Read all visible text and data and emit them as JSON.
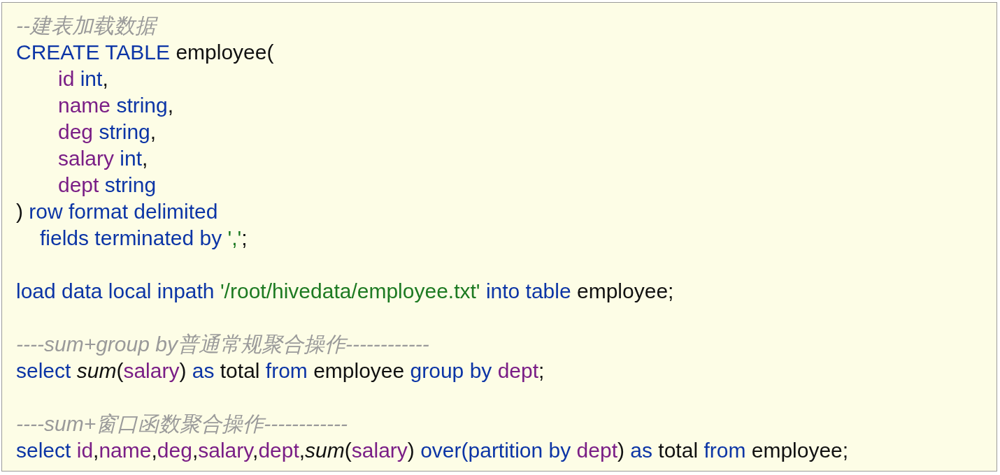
{
  "blocks": [
    {
      "lines": [
        {
          "kind": "plain",
          "tokens": [
            {
              "kind": "comment",
              "text": "--建表加载数据"
            }
          ]
        },
        {
          "kind": "plain",
          "tokens": [
            {
              "kind": "keyword",
              "text": "CREATE TABLE"
            },
            {
              "kind": "plain",
              "text": " employee("
            }
          ]
        },
        {
          "kind": "column",
          "tokens": [
            {
              "kind": "column",
              "text": "id"
            },
            {
              "kind": "keyword",
              "text": " int"
            },
            {
              "kind": "plain",
              "text": ","
            }
          ]
        },
        {
          "kind": "column",
          "tokens": [
            {
              "kind": "column",
              "text": "name"
            },
            {
              "kind": "keyword",
              "text": " string"
            },
            {
              "kind": "plain",
              "text": ","
            }
          ]
        },
        {
          "kind": "column",
          "tokens": [
            {
              "kind": "column",
              "text": "deg"
            },
            {
              "kind": "keyword",
              "text": " string"
            },
            {
              "kind": "plain",
              "text": ","
            }
          ]
        },
        {
          "kind": "column",
          "tokens": [
            {
              "kind": "column",
              "text": "salary"
            },
            {
              "kind": "keyword",
              "text": " int"
            },
            {
              "kind": "plain",
              "text": ","
            }
          ]
        },
        {
          "kind": "column",
          "tokens": [
            {
              "kind": "column",
              "text": "dept"
            },
            {
              "kind": "keyword",
              "text": " string"
            }
          ]
        },
        {
          "kind": "plain",
          "tokens": [
            {
              "kind": "plain",
              "text": ") "
            },
            {
              "kind": "keyword",
              "text": "row format delimited"
            }
          ]
        },
        {
          "kind": "continuation",
          "tokens": [
            {
              "kind": "keyword",
              "text": "fields terminated by "
            },
            {
              "kind": "string",
              "text": "','"
            },
            {
              "kind": "plain",
              "text": ";"
            }
          ]
        }
      ]
    },
    {
      "lines": [
        {
          "kind": "plain",
          "tokens": [
            {
              "kind": "keyword",
              "text": "load data local inpath "
            },
            {
              "kind": "string",
              "text": "'/root/hivedata/employee.txt'"
            },
            {
              "kind": "keyword",
              "text": " into table"
            },
            {
              "kind": "plain",
              "text": " employee;"
            }
          ]
        }
      ]
    },
    {
      "lines": [
        {
          "kind": "plain",
          "tokens": [
            {
              "kind": "comment",
              "text": "----sum+group by普通常规聚合操作------------"
            }
          ]
        },
        {
          "kind": "plain",
          "tokens": [
            {
              "kind": "keyword",
              "text": "select "
            },
            {
              "kind": "function",
              "text": "sum"
            },
            {
              "kind": "plain",
              "text": "("
            },
            {
              "kind": "column",
              "text": "salary"
            },
            {
              "kind": "plain",
              "text": ") "
            },
            {
              "kind": "keyword",
              "text": "as"
            },
            {
              "kind": "plain",
              "text": " total "
            },
            {
              "kind": "keyword",
              "text": "from"
            },
            {
              "kind": "plain",
              "text": " employee "
            },
            {
              "kind": "keyword",
              "text": "group by"
            },
            {
              "kind": "column",
              "text": " dept"
            },
            {
              "kind": "plain",
              "text": ";"
            }
          ]
        }
      ]
    },
    {
      "lines": [
        {
          "kind": "plain",
          "tokens": [
            {
              "kind": "comment",
              "text": "----sum+窗口函数聚合操作------------"
            }
          ]
        },
        {
          "kind": "plain",
          "tokens": [
            {
              "kind": "keyword",
              "text": "select "
            },
            {
              "kind": "column",
              "text": "id"
            },
            {
              "kind": "plain",
              "text": ","
            },
            {
              "kind": "column",
              "text": "name"
            },
            {
              "kind": "plain",
              "text": ","
            },
            {
              "kind": "column",
              "text": "deg"
            },
            {
              "kind": "plain",
              "text": ","
            },
            {
              "kind": "column",
              "text": "salary"
            },
            {
              "kind": "plain",
              "text": ","
            },
            {
              "kind": "column",
              "text": "dept"
            },
            {
              "kind": "plain",
              "text": ","
            },
            {
              "kind": "function",
              "text": "sum"
            },
            {
              "kind": "plain",
              "text": "("
            },
            {
              "kind": "column",
              "text": "salary"
            },
            {
              "kind": "plain",
              "text": ") "
            },
            {
              "kind": "keyword",
              "text": "over(partition by"
            },
            {
              "kind": "column",
              "text": " dept"
            },
            {
              "kind": "plain",
              "text": ") "
            },
            {
              "kind": "keyword",
              "text": "as"
            },
            {
              "kind": "plain",
              "text": " total "
            },
            {
              "kind": "keyword",
              "text": "from"
            },
            {
              "kind": "plain",
              "text": " employee;"
            }
          ]
        }
      ]
    }
  ]
}
